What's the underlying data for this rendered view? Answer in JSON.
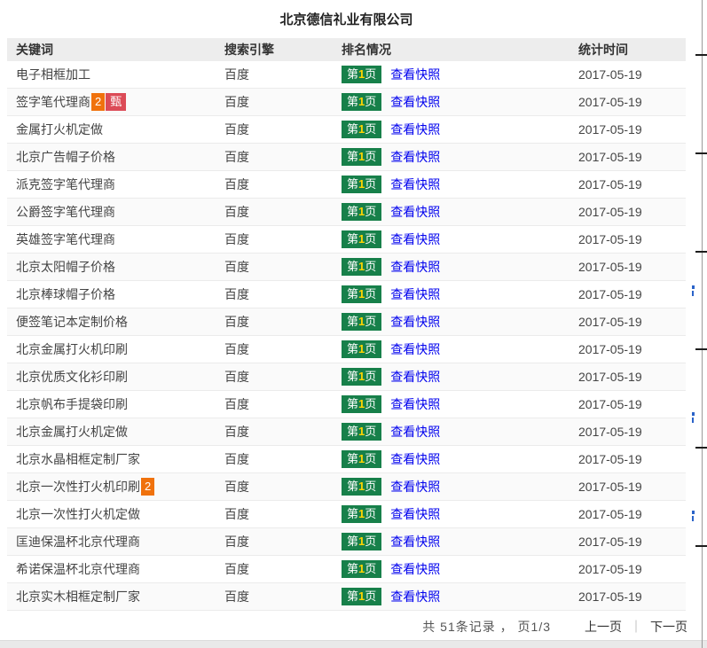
{
  "page": {
    "title": "北京德信礼业有限公司"
  },
  "colors": {
    "rank_badge_bg": "#17804a",
    "rank_number_yellow": "#ffd400",
    "badge_orange": "#f0720d",
    "badge_red": "#dc4b57",
    "link_blue": "#0000ee",
    "header_row_bg": "#ededed"
  },
  "table": {
    "headers": [
      "关键词",
      "搜索引擎",
      "排名情况",
      "统计时间"
    ],
    "rank_badge": {
      "prefix": "第",
      "num": "1",
      "suffix": "页"
    },
    "snapshot_link_label": "查看快照",
    "rows": [
      {
        "keyword": "电子相框加工",
        "engine": "百度",
        "date": "2017-05-19",
        "badges": []
      },
      {
        "keyword": "签字笔代理商",
        "engine": "百度",
        "date": "2017-05-19",
        "badges": [
          {
            "text": "2",
            "type": "orange"
          },
          {
            "text": "甄",
            "type": "red"
          }
        ]
      },
      {
        "keyword": "金属打火机定做",
        "engine": "百度",
        "date": "2017-05-19",
        "badges": []
      },
      {
        "keyword": "北京广告帽子价格",
        "engine": "百度",
        "date": "2017-05-19",
        "badges": []
      },
      {
        "keyword": "派克签字笔代理商",
        "engine": "百度",
        "date": "2017-05-19",
        "badges": []
      },
      {
        "keyword": "公爵签字笔代理商",
        "engine": "百度",
        "date": "2017-05-19",
        "badges": []
      },
      {
        "keyword": "英雄签字笔代理商",
        "engine": "百度",
        "date": "2017-05-19",
        "badges": []
      },
      {
        "keyword": "北京太阳帽子价格",
        "engine": "百度",
        "date": "2017-05-19",
        "badges": []
      },
      {
        "keyword": "北京棒球帽子价格",
        "engine": "百度",
        "date": "2017-05-19",
        "badges": []
      },
      {
        "keyword": "便签笔记本定制价格",
        "engine": "百度",
        "date": "2017-05-19",
        "badges": []
      },
      {
        "keyword": "北京金属打火机印刷",
        "engine": "百度",
        "date": "2017-05-19",
        "badges": []
      },
      {
        "keyword": "北京优质文化衫印刷",
        "engine": "百度",
        "date": "2017-05-19",
        "badges": []
      },
      {
        "keyword": "北京帆布手提袋印刷",
        "engine": "百度",
        "date": "2017-05-19",
        "badges": []
      },
      {
        "keyword": "北京金属打火机定做",
        "engine": "百度",
        "date": "2017-05-19",
        "badges": []
      },
      {
        "keyword": "北京水晶相框定制厂家",
        "engine": "百度",
        "date": "2017-05-19",
        "badges": []
      },
      {
        "keyword": "北京一次性打火机印刷",
        "engine": "百度",
        "date": "2017-05-19",
        "badges": [
          {
            "text": "2",
            "type": "orange"
          }
        ]
      },
      {
        "keyword": "北京一次性打火机定做",
        "engine": "百度",
        "date": "2017-05-19",
        "badges": []
      },
      {
        "keyword": "匡迪保温杯北京代理商",
        "engine": "百度",
        "date": "2017-05-19",
        "badges": []
      },
      {
        "keyword": "希诺保温杯北京代理商",
        "engine": "百度",
        "date": "2017-05-19",
        "badges": []
      },
      {
        "keyword": "北京实木相框定制厂家",
        "engine": "百度",
        "date": "2017-05-19",
        "badges": []
      }
    ]
  },
  "footer": {
    "summary": "共 51条记录 ， 页1/3",
    "prev_label": "上一页",
    "separator": "｜",
    "next_label": "下一页"
  }
}
